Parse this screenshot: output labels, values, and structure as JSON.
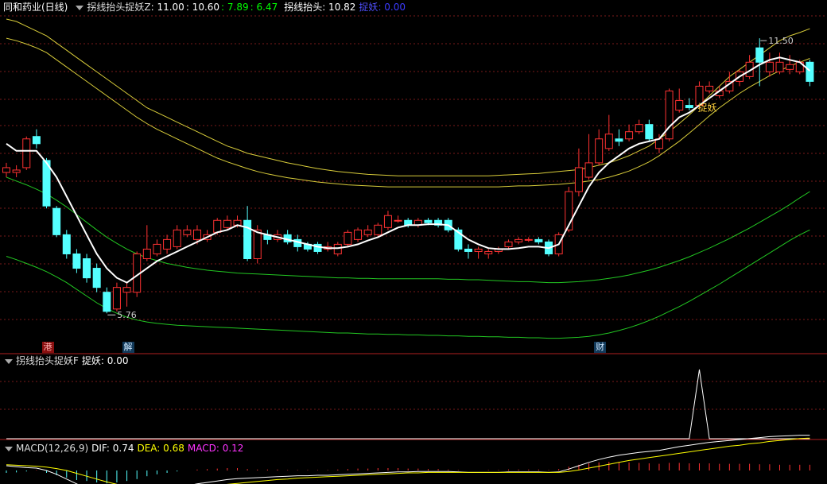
{
  "main_header": {
    "stock": "同和药业(日线)",
    "indicator": "拐线抬头捉妖Z",
    "values": [
      {
        "text": ": 11.00",
        "color": "#ffffff"
      },
      {
        "text": ": 10.60",
        "color": "#ffffff"
      },
      {
        "text": ": 7.89",
        "color": "#00ff00"
      },
      {
        "text": ": 6.47",
        "color": "#00ff00"
      }
    ],
    "line_label": "拐线抬头: 10.82",
    "zhuoyao_label": "捉妖",
    "zhuoyao_value": ": 0.00"
  },
  "sub_header": {
    "title": "拐线抬头捉妖F",
    "value": "捉妖: 0.00"
  },
  "macd_header": {
    "title": "MACD(12,26,9)",
    "dif": "DIF: 0.74",
    "dea": "DEA: 0.68",
    "macd": "MACD: 0.12"
  },
  "annotations": {
    "high": "11.50",
    "low": "5.76",
    "signal": "捉妖"
  },
  "markers": [
    {
      "text": "港",
      "bar": 4
    },
    {
      "text": "解",
      "bar": 12
    },
    {
      "text": "财",
      "bar": 59
    }
  ],
  "colors": {
    "up": "#ff3232",
    "down": "#54ffff",
    "line": "#ffffff",
    "upper": "#d8cc3a",
    "lower": "#22c722",
    "grid": "#7a1a1a",
    "spike": "#ffffff"
  },
  "chart_data": {
    "type": "candlestick",
    "price_range": [
      5.2,
      12.0
    ],
    "candles": [
      [
        8.7,
        8.8,
        8.9,
        8.6
      ],
      [
        8.7,
        8.75,
        8.85,
        8.6
      ],
      [
        8.8,
        9.4,
        9.45,
        8.75
      ],
      [
        9.45,
        9.3,
        9.6,
        9.2
      ],
      [
        8.95,
        8.0,
        9.0,
        7.95
      ],
      [
        7.95,
        7.4,
        8.0,
        7.35
      ],
      [
        7.4,
        7.0,
        7.5,
        6.9
      ],
      [
        7.0,
        6.7,
        7.1,
        6.6
      ],
      [
        6.9,
        6.5,
        7.0,
        6.4
      ],
      [
        6.7,
        6.3,
        6.8,
        6.2
      ],
      [
        6.2,
        5.8,
        6.3,
        5.76
      ],
      [
        5.85,
        6.3,
        6.4,
        5.8
      ],
      [
        6.2,
        6.3,
        6.4,
        5.9
      ],
      [
        6.2,
        7.0,
        7.05,
        6.1
      ],
      [
        6.9,
        7.1,
        7.6,
        6.85
      ],
      [
        7.0,
        7.2,
        7.3,
        6.95
      ],
      [
        7.1,
        7.3,
        7.4,
        7.0
      ],
      [
        7.15,
        7.5,
        7.6,
        7.1
      ],
      [
        7.4,
        7.5,
        7.6,
        7.35
      ],
      [
        7.3,
        7.5,
        7.6,
        7.2
      ],
      [
        7.3,
        7.4,
        7.5,
        7.25
      ],
      [
        7.45,
        7.7,
        7.75,
        7.4
      ],
      [
        7.55,
        7.7,
        7.8,
        7.5
      ],
      [
        7.6,
        7.7,
        7.8,
        7.55
      ],
      [
        7.7,
        6.9,
        8.0,
        6.85
      ],
      [
        6.9,
        7.5,
        7.6,
        6.8
      ],
      [
        7.4,
        7.3,
        7.5,
        7.2
      ],
      [
        7.3,
        7.4,
        7.5,
        7.25
      ],
      [
        7.4,
        7.25,
        7.5,
        7.2
      ],
      [
        7.3,
        7.15,
        7.4,
        7.05
      ],
      [
        7.2,
        7.1,
        7.25,
        7.05
      ],
      [
        7.2,
        7.05,
        7.25,
        7.0
      ],
      [
        7.1,
        7.15,
        7.25,
        7.05
      ],
      [
        7.0,
        7.2,
        7.25,
        6.95
      ],
      [
        7.2,
        7.45,
        7.5,
        7.15
      ],
      [
        7.3,
        7.5,
        7.55,
        7.25
      ],
      [
        7.4,
        7.5,
        7.6,
        7.35
      ],
      [
        7.4,
        7.6,
        7.65,
        7.35
      ],
      [
        7.55,
        7.8,
        7.9,
        7.5
      ],
      [
        7.7,
        7.7,
        7.8,
        7.65
      ],
      [
        7.7,
        7.6,
        7.75,
        7.55
      ],
      [
        7.6,
        7.7,
        7.75,
        7.55
      ],
      [
        7.7,
        7.65,
        7.75,
        7.6
      ],
      [
        7.7,
        7.6,
        7.75,
        7.55
      ],
      [
        7.7,
        7.5,
        7.75,
        7.45
      ],
      [
        7.5,
        7.1,
        7.55,
        7.05
      ],
      [
        7.1,
        7.05,
        7.2,
        6.9
      ],
      [
        7.05,
        7.1,
        7.15,
        6.9
      ],
      [
        7.0,
        7.05,
        7.1,
        6.9
      ],
      [
        7.05,
        7.1,
        7.15,
        7.0
      ],
      [
        7.15,
        7.25,
        7.3,
        7.1
      ],
      [
        7.25,
        7.3,
        7.35,
        7.2
      ],
      [
        7.3,
        7.3,
        7.35,
        7.25
      ],
      [
        7.3,
        7.25,
        7.35,
        7.2
      ],
      [
        7.25,
        7.0,
        7.3,
        6.95
      ],
      [
        7.0,
        7.4,
        7.45,
        6.95
      ],
      [
        7.5,
        8.3,
        8.4,
        7.45
      ],
      [
        8.3,
        8.8,
        9.2,
        8.2
      ],
      [
        8.6,
        8.9,
        9.5,
        8.55
      ],
      [
        8.9,
        9.4,
        9.6,
        8.85
      ],
      [
        9.2,
        9.5,
        9.9,
        9.15
      ],
      [
        9.4,
        9.35,
        9.6,
        9.25
      ],
      [
        9.4,
        9.55,
        9.7,
        9.35
      ],
      [
        9.55,
        9.7,
        9.8,
        9.5
      ],
      [
        9.7,
        9.4,
        9.8,
        9.35
      ],
      [
        9.2,
        9.4,
        9.5,
        9.1
      ],
      [
        9.4,
        10.4,
        10.45,
        9.35
      ],
      [
        10.0,
        10.2,
        10.45,
        9.95
      ],
      [
        10.1,
        10.05,
        10.25,
        10.0
      ],
      [
        10.1,
        10.5,
        10.6,
        10.05
      ],
      [
        10.4,
        10.5,
        10.6,
        10.35
      ],
      [
        10.3,
        10.4,
        10.5,
        10.25
      ],
      [
        10.4,
        10.6,
        10.8,
        10.35
      ],
      [
        10.6,
        10.8,
        10.85,
        10.5
      ],
      [
        10.7,
        11.0,
        11.15,
        10.65
      ],
      [
        11.3,
        11.0,
        11.5,
        10.5
      ],
      [
        10.8,
        11.0,
        11.2,
        10.7
      ],
      [
        10.8,
        11.0,
        11.2,
        10.75
      ],
      [
        10.85,
        10.95,
        11.15,
        10.75
      ],
      [
        10.8,
        11.0,
        11.05,
        10.75
      ],
      [
        11.0,
        10.6,
        11.05,
        10.5
      ]
    ],
    "trend_line": [
      9.3,
      9.15,
      9.15,
      9.15,
      8.9,
      8.6,
      8.2,
      7.8,
      7.4,
      7.0,
      6.7,
      6.5,
      6.4,
      6.55,
      6.7,
      6.85,
      6.95,
      7.05,
      7.15,
      7.25,
      7.35,
      7.45,
      7.5,
      7.6,
      7.55,
      7.45,
      7.4,
      7.35,
      7.3,
      7.25,
      7.2,
      7.15,
      7.12,
      7.12,
      7.15,
      7.2,
      7.28,
      7.35,
      7.45,
      7.55,
      7.6,
      7.6,
      7.62,
      7.62,
      7.6,
      7.45,
      7.3,
      7.2,
      7.12,
      7.1,
      7.1,
      7.12,
      7.15,
      7.15,
      7.12,
      7.2,
      7.6,
      8.0,
      8.4,
      8.7,
      8.9,
      9.05,
      9.2,
      9.3,
      9.35,
      9.4,
      9.65,
      9.85,
      9.95,
      10.1,
      10.25,
      10.4,
      10.55,
      10.7,
      10.82,
      10.95,
      11.05,
      11.1,
      11.05,
      11.0,
      10.82
    ],
    "band_upper": [
      11.9,
      11.85,
      11.75,
      11.65,
      11.55,
      11.4,
      11.25,
      11.1,
      10.95,
      10.8,
      10.65,
      10.5,
      10.35,
      10.2,
      10.05,
      9.95,
      9.85,
      9.75,
      9.65,
      9.55,
      9.45,
      9.35,
      9.25,
      9.18,
      9.1,
      9.05,
      9.0,
      8.95,
      8.9,
      8.86,
      8.82,
      8.78,
      8.75,
      8.72,
      8.7,
      8.68,
      8.66,
      8.65,
      8.64,
      8.63,
      8.63,
      8.63,
      8.63,
      8.63,
      8.63,
      8.63,
      8.63,
      8.63,
      8.63,
      8.64,
      8.65,
      8.66,
      8.67,
      8.68,
      8.7,
      8.72,
      8.74,
      8.76,
      8.8,
      8.85,
      8.9,
      8.97,
      9.05,
      9.15,
      9.25,
      9.4,
      9.55,
      9.72,
      9.9,
      10.1,
      10.3,
      10.5,
      10.7,
      10.85,
      11.0,
      11.15,
      11.3,
      11.45,
      11.55,
      11.62,
      11.7
    ],
    "band_upper2": [
      11.5,
      11.45,
      11.38,
      11.3,
      11.2,
      11.05,
      10.9,
      10.75,
      10.6,
      10.45,
      10.3,
      10.15,
      10.0,
      9.85,
      9.72,
      9.6,
      9.5,
      9.4,
      9.3,
      9.2,
      9.1,
      9.0,
      8.92,
      8.85,
      8.78,
      8.72,
      8.67,
      8.63,
      8.59,
      8.56,
      8.53,
      8.5,
      8.48,
      8.46,
      8.44,
      8.43,
      8.42,
      8.41,
      8.4,
      8.4,
      8.4,
      8.4,
      8.4,
      8.4,
      8.4,
      8.4,
      8.4,
      8.4,
      8.4,
      8.4,
      8.41,
      8.42,
      8.42,
      8.43,
      8.44,
      8.45,
      8.47,
      8.49,
      8.52,
      8.55,
      8.6,
      8.66,
      8.73,
      8.82,
      8.92,
      9.05,
      9.2,
      9.35,
      9.52,
      9.7,
      9.88,
      10.05,
      10.2,
      10.35,
      10.48,
      10.6,
      10.72,
      10.82,
      10.92,
      11.0,
      11.08
    ],
    "band_lower": [
      8.6,
      8.52,
      8.44,
      8.35,
      8.25,
      8.12,
      7.98,
      7.82,
      7.66,
      7.5,
      7.35,
      7.22,
      7.1,
      7.0,
      6.92,
      6.86,
      6.8,
      6.76,
      6.72,
      6.69,
      6.66,
      6.64,
      6.62,
      6.6,
      6.59,
      6.58,
      6.57,
      6.56,
      6.55,
      6.54,
      6.53,
      6.52,
      6.51,
      6.5,
      6.5,
      6.49,
      6.49,
      6.48,
      6.48,
      6.48,
      6.48,
      6.48,
      6.48,
      6.48,
      6.47,
      6.47,
      6.46,
      6.46,
      6.45,
      6.44,
      6.43,
      6.42,
      6.42,
      6.41,
      6.4,
      6.4,
      6.41,
      6.42,
      6.44,
      6.46,
      6.49,
      6.52,
      6.56,
      6.61,
      6.66,
      6.72,
      6.79,
      6.86,
      6.94,
      7.03,
      7.12,
      7.22,
      7.32,
      7.43,
      7.54,
      7.66,
      7.78,
      7.9,
      8.03,
      8.17,
      8.3
    ],
    "band_lower2": [
      6.95,
      6.88,
      6.8,
      6.72,
      6.63,
      6.52,
      6.4,
      6.26,
      6.12,
      5.98,
      5.86,
      5.76,
      5.68,
      5.62,
      5.58,
      5.55,
      5.53,
      5.51,
      5.5,
      5.49,
      5.48,
      5.47,
      5.46,
      5.45,
      5.44,
      5.43,
      5.42,
      5.41,
      5.4,
      5.39,
      5.38,
      5.37,
      5.36,
      5.35,
      5.35,
      5.34,
      5.33,
      5.33,
      5.32,
      5.32,
      5.31,
      5.31,
      5.3,
      5.3,
      5.29,
      5.29,
      5.28,
      5.28,
      5.27,
      5.27,
      5.26,
      5.26,
      5.25,
      5.25,
      5.24,
      5.24,
      5.25,
      5.26,
      5.28,
      5.31,
      5.35,
      5.4,
      5.46,
      5.53,
      5.61,
      5.7,
      5.8,
      5.9,
      6.01,
      6.13,
      6.25,
      6.37,
      6.5,
      6.63,
      6.76,
      6.89,
      7.02,
      7.15,
      7.28,
      7.4,
      7.5
    ],
    "signal_bars": [
      69
    ],
    "macd_hist": [
      -0.05,
      -0.04,
      -0.02,
      0.01,
      -0.05,
      -0.1,
      -0.15,
      -0.2,
      -0.22,
      -0.25,
      -0.27,
      -0.25,
      -0.22,
      -0.18,
      -0.12,
      -0.08,
      -0.05,
      -0.02,
      0.0,
      0.02,
      0.03,
      0.04,
      0.05,
      0.05,
      0.03,
      0.02,
      0.02,
      0.02,
      0.01,
      0.01,
      0.01,
      0.01,
      0.01,
      0.02,
      0.03,
      0.04,
      0.04,
      0.05,
      0.05,
      0.05,
      0.04,
      0.04,
      0.03,
      0.03,
      0.02,
      0.01,
      0.0,
      0.0,
      0.01,
      0.01,
      0.02,
      0.02,
      0.02,
      0.02,
      0.01,
      0.03,
      0.08,
      0.12,
      0.15,
      0.17,
      0.18,
      0.18,
      0.17,
      0.16,
      0.15,
      0.14,
      0.16,
      0.16,
      0.15,
      0.15,
      0.15,
      0.14,
      0.14,
      0.14,
      0.14,
      0.13,
      0.13,
      0.12,
      0.12,
      0.12,
      0.12
    ],
    "macd_dif": [
      0.1,
      0.08,
      0.06,
      0.05,
      0.0,
      -0.08,
      -0.18,
      -0.28,
      -0.38,
      -0.46,
      -0.52,
      -0.55,
      -0.55,
      -0.52,
      -0.48,
      -0.44,
      -0.4,
      -0.36,
      -0.32,
      -0.28,
      -0.25,
      -0.22,
      -0.19,
      -0.17,
      -0.16,
      -0.15,
      -0.14,
      -0.13,
      -0.12,
      -0.11,
      -0.11,
      -0.1,
      -0.1,
      -0.09,
      -0.08,
      -0.07,
      -0.06,
      -0.05,
      -0.04,
      -0.03,
      -0.03,
      -0.02,
      -0.02,
      -0.02,
      -0.02,
      -0.03,
      -0.04,
      -0.04,
      -0.04,
      -0.04,
      -0.03,
      -0.03,
      -0.03,
      -0.03,
      -0.04,
      -0.03,
      0.03,
      0.1,
      0.17,
      0.23,
      0.28,
      0.32,
      0.35,
      0.38,
      0.4,
      0.42,
      0.46,
      0.5,
      0.53,
      0.56,
      0.59,
      0.61,
      0.63,
      0.65,
      0.67,
      0.69,
      0.71,
      0.72,
      0.73,
      0.74,
      0.74
    ],
    "macd_dea": [
      0.12,
      0.11,
      0.1,
      0.09,
      0.07,
      0.04,
      0.0,
      -0.06,
      -0.12,
      -0.18,
      -0.24,
      -0.29,
      -0.33,
      -0.36,
      -0.38,
      -0.39,
      -0.39,
      -0.38,
      -0.37,
      -0.35,
      -0.33,
      -0.31,
      -0.29,
      -0.27,
      -0.25,
      -0.23,
      -0.21,
      -0.19,
      -0.18,
      -0.16,
      -0.15,
      -0.14,
      -0.13,
      -0.12,
      -0.11,
      -0.1,
      -0.09,
      -0.08,
      -0.07,
      -0.06,
      -0.05,
      -0.05,
      -0.04,
      -0.04,
      -0.04,
      -0.04,
      -0.04,
      -0.04,
      -0.04,
      -0.04,
      -0.04,
      -0.04,
      -0.04,
      -0.04,
      -0.04,
      -0.04,
      -0.02,
      0.01,
      0.05,
      0.09,
      0.13,
      0.17,
      0.21,
      0.24,
      0.27,
      0.3,
      0.33,
      0.36,
      0.39,
      0.42,
      0.45,
      0.48,
      0.51,
      0.53,
      0.56,
      0.58,
      0.61,
      0.63,
      0.65,
      0.67,
      0.68
    ]
  }
}
